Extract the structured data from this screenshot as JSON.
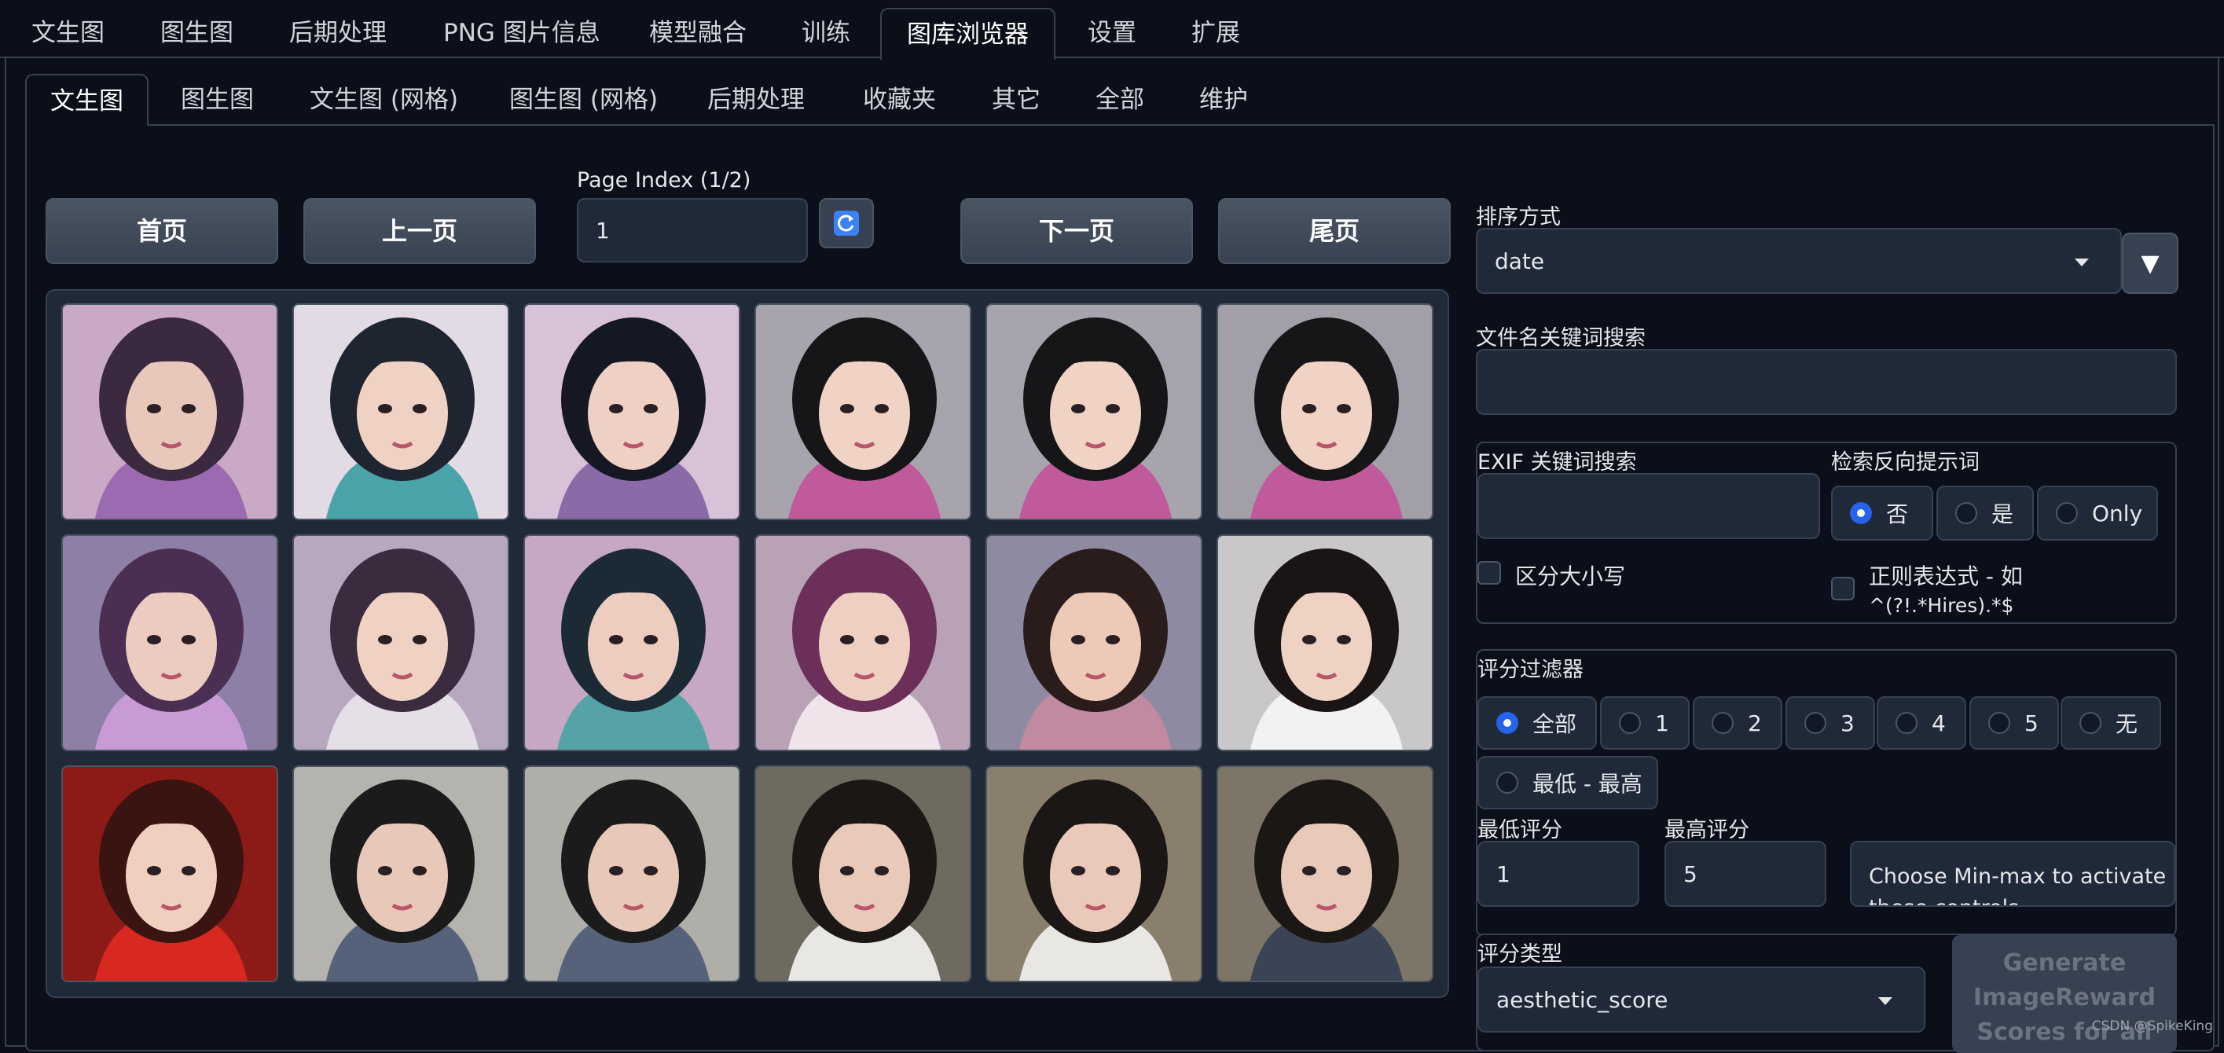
{
  "top_tabs": [
    "文生图",
    "图生图",
    "后期处理",
    "PNG 图片信息",
    "模型融合",
    "训练",
    "图库浏览器",
    "设置",
    "扩展"
  ],
  "sub_tabs": [
    "文生图",
    "图生图",
    "文生图 (网格)",
    "图生图 (网格)",
    "后期处理",
    "收藏夹",
    "其它",
    "全部",
    "维护"
  ],
  "nav": {
    "first": "首页",
    "prev": "上一页",
    "page_index_label": "Page Index (1/2)",
    "page_index_value": "1",
    "next": "下一页",
    "last": "尾页"
  },
  "sort": {
    "label": "排序方式",
    "value": "date",
    "direction_button": "▼"
  },
  "filename_search": {
    "label": "文件名关键词搜索",
    "value": ""
  },
  "exif_search": {
    "label": "EXIF 关键词搜索",
    "value": ""
  },
  "negative_search": {
    "label": "检索反向提示词",
    "options": [
      "否",
      "是",
      "Only"
    ],
    "selected": "否"
  },
  "case_sensitive": {
    "label": "区分大小写"
  },
  "regex": {
    "label_line1": "正则表达式 - 如",
    "label_line2": "^(?!.*Hires).*$"
  },
  "score_filter": {
    "label": "评分过滤器",
    "options": [
      "全部",
      "1",
      "2",
      "3",
      "4",
      "5",
      "无",
      "最低 - 最高"
    ],
    "selected": "全部"
  },
  "min_score": {
    "label": "最低评分",
    "value": "1"
  },
  "max_score": {
    "label": "最高评分",
    "value": "5"
  },
  "minmax_note": "Choose Min-max to activate these controls",
  "score_type": {
    "label": "评分类型",
    "value": "aesthetic_score"
  },
  "generate_button": "Generate ImageReward Scores for all",
  "watermark": "CSDN @SpikeKing",
  "thumbnails": [
    {
      "bg": "#c9a9c6",
      "hair": "#3b2a3f",
      "accent": "#9b6ab0",
      "skin": "#e9c8bc"
    },
    {
      "bg": "#e2dbe6",
      "hair": "#1f2530",
      "accent": "#4aa3a8",
      "skin": "#efd2c4"
    },
    {
      "bg": "#d8c2d8",
      "hair": "#151822",
      "accent": "#8a6ba8",
      "skin": "#eed0c4"
    },
    {
      "bg": "#a7a4ad",
      "hair": "#161618",
      "accent": "#c05a9a",
      "skin": "#f0d3c4"
    },
    {
      "bg": "#a7a4ad",
      "hair": "#161618",
      "accent": "#c05a9a",
      "skin": "#f0d3c4"
    },
    {
      "bg": "#a39fa8",
      "hair": "#161618",
      "accent": "#c05a9a",
      "skin": "#f0d3c4"
    },
    {
      "bg": "#8e7fa6",
      "hair": "#4a2f52",
      "accent": "#c89ad6",
      "skin": "#eccbc0"
    },
    {
      "bg": "#b7a8bf",
      "hair": "#3a2b3e",
      "accent": "#e6dfe8",
      "skin": "#f0d2c4"
    },
    {
      "bg": "#c6a7c4",
      "hair": "#1c2a36",
      "accent": "#55a3a6",
      "skin": "#eccdbf"
    },
    {
      "bg": "#b9a2b6",
      "hair": "#6b2f5a",
      "accent": "#f0e3ea",
      "skin": "#eecfc2"
    },
    {
      "bg": "#8d8aa1",
      "hair": "#2b1c1c",
      "accent": "#c08aa0",
      "skin": "#edc9b8"
    },
    {
      "bg": "#c9c7c8",
      "hair": "#1a1414",
      "accent": "#f3f2f2",
      "skin": "#eed2c4"
    },
    {
      "bg": "#8c1a16",
      "hair": "#3a1410",
      "accent": "#d8281f",
      "skin": "#efcfbf"
    },
    {
      "bg": "#b5b3ad",
      "hair": "#1b1b1b",
      "accent": "#55627a",
      "skin": "#e8c8b8"
    },
    {
      "bg": "#b0aea8",
      "hair": "#1b1b1b",
      "accent": "#55627a",
      "skin": "#e8c8b8"
    },
    {
      "bg": "#6f6a60",
      "hair": "#1b1714",
      "accent": "#e9e7e3",
      "skin": "#e9c9b9"
    },
    {
      "bg": "#8a7e6c",
      "hair": "#1b1714",
      "accent": "#e9e7e3",
      "skin": "#e9c9b9"
    },
    {
      "bg": "#7d7568",
      "hair": "#1b1714",
      "accent": "#3a4455",
      "skin": "#e9c9b9"
    }
  ]
}
